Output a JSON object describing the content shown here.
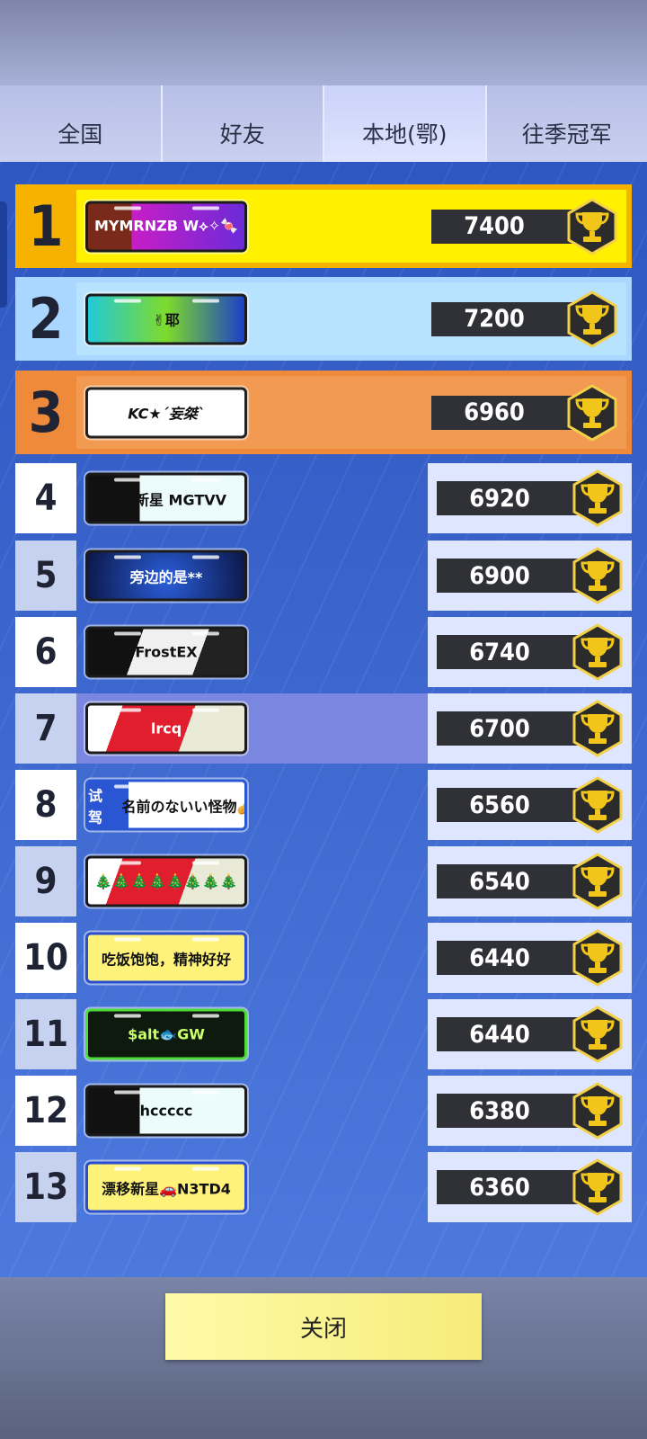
{
  "tabs": [
    {
      "label": "全国"
    },
    {
      "label": "好友"
    },
    {
      "label": "本地(鄂)"
    },
    {
      "label": "往季冠军"
    }
  ],
  "colors": {
    "gold": "#ffd21a",
    "silver": "#b7e0ff",
    "bronze": "#f09a4f",
    "row_left": "#ffffff",
    "row_right": "#dfe6ff",
    "row_alt_left": "#c7d2f0"
  },
  "rows": [
    {
      "rank": "1",
      "name": "MYMRNZB W⟡✧🍬",
      "score": "7400",
      "plate": "purple-lion"
    },
    {
      "rank": "2",
      "name": "✌耶",
      "score": "7200",
      "plate": "neon-x"
    },
    {
      "rank": "3",
      "name": "KC★´妄桀`",
      "score": "6960",
      "plate": "welcome-white"
    },
    {
      "rank": "4",
      "name": "漂移新星 MGTVV",
      "score": "6920",
      "plate": "taptap"
    },
    {
      "rank": "5",
      "name": "旁边的是**",
      "score": "6900",
      "plate": "blue-space"
    },
    {
      "rank": "6",
      "name": "FrostEX",
      "score": "6740",
      "plate": "frost"
    },
    {
      "rank": "7",
      "name": "lrcq",
      "score": "6700",
      "plate": "christmas"
    },
    {
      "rank": "8",
      "name": "名前のないい怪物🥜",
      "score": "6560",
      "plate": "test-drive",
      "prefix": "试驾"
    },
    {
      "rank": "9",
      "name": "🎄🎄🎄🎄🎄🎄🎄🎄",
      "score": "6540",
      "plate": "christmas-trees"
    },
    {
      "rank": "10",
      "name": "吃饭饱饱，精神好好",
      "score": "6440",
      "plate": "yellow-blue"
    },
    {
      "rank": "11",
      "name": "$alt🐟GW",
      "score": "6440",
      "plate": "green-lightning"
    },
    {
      "rank": "12",
      "name": "hccccc",
      "score": "6380",
      "plate": "taptap"
    },
    {
      "rank": "13",
      "name": "漂移新星🚗N3TD4",
      "score": "6360",
      "plate": "yellow-blue"
    }
  ],
  "close_label": "关闭"
}
